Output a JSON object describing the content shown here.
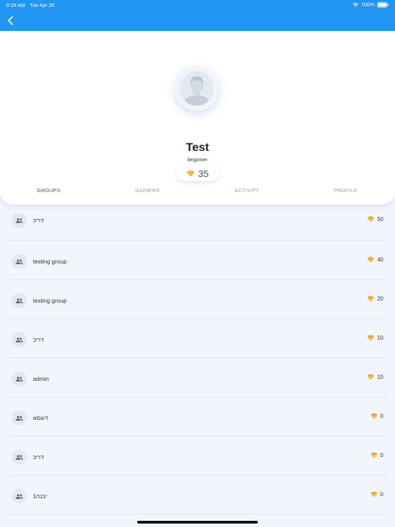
{
  "status_bar": {
    "time": "9:29 AM",
    "date": "Tue Apr 26",
    "battery": "100%"
  },
  "profile": {
    "name": "Test",
    "level": "beginner",
    "points": "35"
  },
  "tabs": [
    {
      "label": "GROUPS",
      "active": true
    },
    {
      "label": "GAINERS",
      "active": false
    },
    {
      "label": "ACTIVITY",
      "active": false
    },
    {
      "label": "PROFILE",
      "active": false
    }
  ],
  "groups": [
    {
      "name": "דריכ",
      "points": "50"
    },
    {
      "name": "testing group",
      "points": "40"
    },
    {
      "name": "testing group",
      "points": "20"
    },
    {
      "name": "דריכ",
      "points": "10"
    },
    {
      "name": "admin",
      "points": "10"
    },
    {
      "name": "דוגמא",
      "points": "0"
    },
    {
      "name": "דריכ",
      "points": "0"
    },
    {
      "name": "יבנה1",
      "points": "0"
    }
  ],
  "colors": {
    "header": "#2196f3",
    "active_tab": "#3a4a8c",
    "gem": "#f5a623"
  }
}
